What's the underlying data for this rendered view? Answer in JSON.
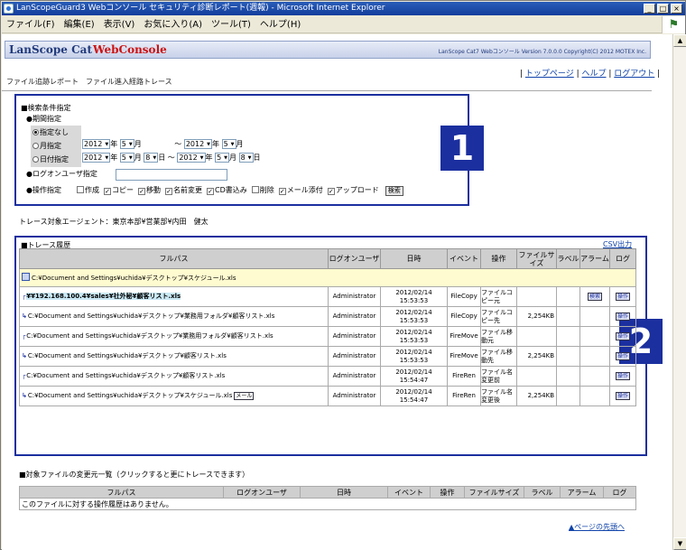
{
  "window": {
    "title": "LanScopeGuard3 Webコンソール セキュリティ診断レポート(週報) - Microsoft Internet Explorer",
    "minimize": "_",
    "maximize": "□",
    "close": "×"
  },
  "menu": [
    "ファイル(F)",
    "編集(E)",
    "表示(V)",
    "お気に入り(A)",
    "ツール(T)",
    "ヘルプ(H)"
  ],
  "header": {
    "logo": "LanScope Cat",
    "webconsole": "WebConsole",
    "version": "LanScope Cat7 Webコンソール Version 7.0.0.0 Copyright(C) 2012 MOTEX Inc."
  },
  "toplinks": {
    "top": "トップページ",
    "help": "ヘルプ",
    "logout": "ログアウト"
  },
  "breadcrumb": "ファイル追跡レポート　ファイル進入経路トレース",
  "badges": {
    "one": "1",
    "two": "2"
  },
  "conditions": {
    "title": "■検索条件指定",
    "period": "●期間指定",
    "radio_none": "指定なし",
    "radio_month": "月指定",
    "radio_day": "日付指定",
    "year1": "2012",
    "month1": "5",
    "year2": "2012",
    "month2": "5",
    "year3": "2012",
    "month3": "5",
    "day3": "8",
    "year4": "2012",
    "month4": "5",
    "day4": "8",
    "year_unit": "年",
    "month_unit": "月",
    "day_unit": "日",
    "tilde": "～",
    "logon_label": "●ログオンユーザ指定",
    "op_label": "●操作指定",
    "ops": [
      {
        "label": "作成",
        "checked": false
      },
      {
        "label": "コピー",
        "checked": true
      },
      {
        "label": "移動",
        "checked": true
      },
      {
        "label": "名前変更",
        "checked": true
      },
      {
        "label": "CD書込み",
        "checked": true
      },
      {
        "label": "削除",
        "checked": false
      },
      {
        "label": "メール添付",
        "checked": true
      },
      {
        "label": "アップロード",
        "checked": true
      }
    ],
    "search_button": "検索"
  },
  "agent": "トレース対象エージェント：東京本部¥営業部¥内田　健太",
  "trace": {
    "title": "■トレース履歴",
    "csv": "CSV出力",
    "headers": [
      "フルパス",
      "ログオンユーザ",
      "日時",
      "イベント",
      "操作",
      "ファイルサイズ",
      "ラベル",
      "アラーム",
      "ログ"
    ],
    "first_path": "C:¥Document and Settings¥uchida¥デスクトップ¥スケジュール.xls",
    "rows": [
      {
        "path": "¥¥192.168.100.4¥sales¥社外秘¥顧客リスト.xls",
        "user": "Administrator",
        "date": "2012/02/14",
        "time": "15:53:53",
        "event": "FileCopy",
        "op": "ファイルコピー元",
        "size": "",
        "alarm": "検索",
        "log": "操作"
      },
      {
        "path": "C:¥Document and Settings¥uchida¥デスクトップ¥業務用フォルダ¥顧客リスト.xls",
        "user": "Administrator",
        "date": "2012/02/14",
        "time": "15:53:53",
        "event": "FileCopy",
        "op": "ファイルコピー先",
        "size": "2,254KB",
        "alarm": "",
        "log": "操作"
      },
      {
        "path": "C:¥Document and Settings¥uchida¥デスクトップ¥業務用フォルダ¥顧客リスト.xls",
        "user": "Administrator",
        "date": "2012/02/14",
        "time": "15:53:53",
        "event": "FireMove",
        "op": "ファイル移動元",
        "size": "",
        "alarm": "",
        "log": "操作"
      },
      {
        "path": "C:¥Document and Settings¥uchida¥デスクトップ¥顧客リスト.xls",
        "user": "Administrator",
        "date": "2012/02/14",
        "time": "15:53:53",
        "event": "FireMove",
        "op": "ファイル移動先",
        "size": "2,254KB",
        "alarm": "",
        "log": "操作"
      },
      {
        "path": "C:¥Document and Settings¥uchida¥デスクトップ¥顧客リスト.xls",
        "user": "Administrator",
        "date": "2012/02/14",
        "time": "15:54:47",
        "event": "FireRen",
        "op": "ファイル名変更前",
        "size": "",
        "alarm": "",
        "log": "操作"
      },
      {
        "path": "C:¥Document and Settings¥uchida¥デスクトップ¥スケジュール.xls",
        "user": "Administrator",
        "date": "2012/02/14",
        "time": "15:54:47",
        "event": "FireRen",
        "op": "ファイル名変更後",
        "size": "2,254KB",
        "alarm": "",
        "log": "操作",
        "mail": "メール"
      }
    ]
  },
  "changes": {
    "title": "■対象ファイルの変更元一覧（クリックすると更にトレースできます）",
    "headers": [
      "フルパス",
      "ログオンユーザ",
      "日時",
      "イベント",
      "操作",
      "ファイルサイズ",
      "ラベル",
      "アラーム",
      "ログ"
    ],
    "empty": "このファイルに対する操作履歴はありません。"
  },
  "pagetop": "▲ページの先頭へ"
}
